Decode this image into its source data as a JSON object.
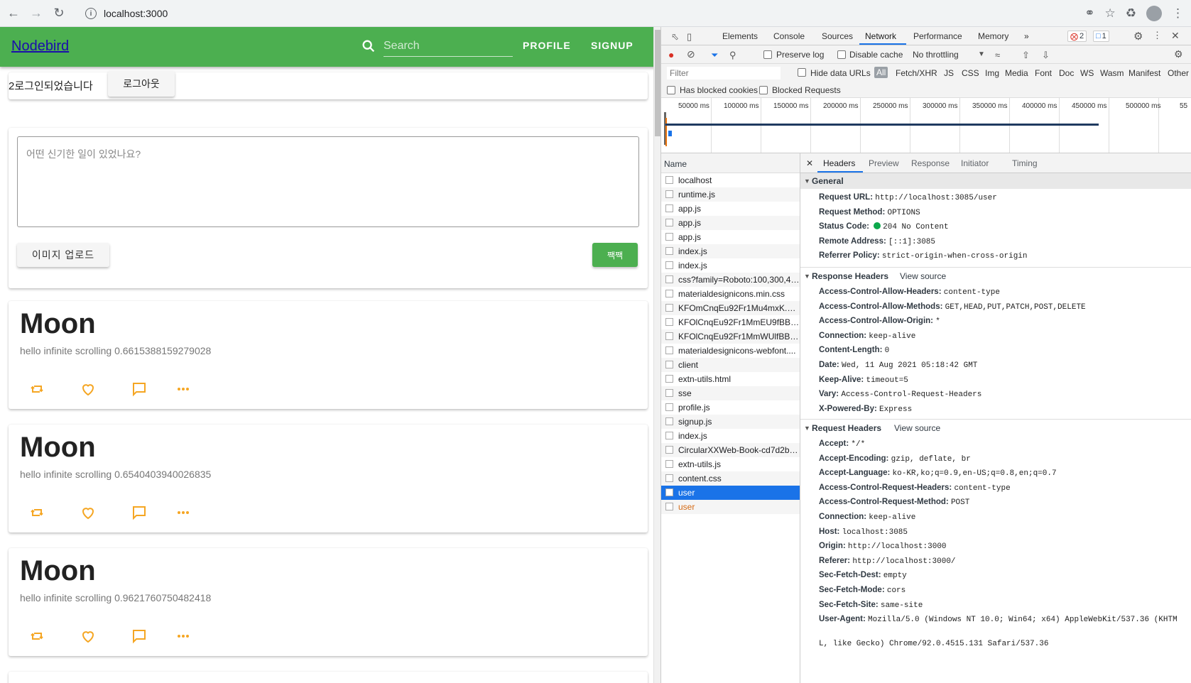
{
  "browser": {
    "url": "localhost:3000",
    "back_icon": "arrow-left-icon",
    "forward_icon": "arrow-right-icon",
    "reload_icon": "reload-icon"
  },
  "app": {
    "brand": "Nodebird",
    "search_placeholder": "Search",
    "nav": [
      "PROFILE",
      "SIGNUP"
    ],
    "login_text": "2로그인되었습니다",
    "logout_label": "로그아웃",
    "post_placeholder": "어떤 신기한 일이 있었나요?",
    "upload_label": "이미지 업로드",
    "submit_label": "짹짹",
    "accent": "#4caf50",
    "action_color": "#f5a623",
    "posts": [
      {
        "title": "Moon",
        "body": "hello infinite scrolling 0.6615388159279028"
      },
      {
        "title": "Moon",
        "body": "hello infinite scrolling 0.6540403940026835"
      },
      {
        "title": "Moon",
        "body": "hello infinite scrolling 0.9621760750482418"
      }
    ]
  },
  "devtools": {
    "tabs": [
      "Elements",
      "Console",
      "Sources",
      "Network",
      "Performance",
      "Memory"
    ],
    "active_tab": "Network",
    "error_count": "2",
    "message_count": "1",
    "toolbar": {
      "preserve_log": "Preserve log",
      "disable_cache": "Disable cache",
      "throttling": "No throttling"
    },
    "filter_placeholder": "Filter",
    "hide_data_urls": "Hide data URLs",
    "filter_types": [
      "All",
      "Fetch/XHR",
      "JS",
      "CSS",
      "Img",
      "Media",
      "Font",
      "Doc",
      "WS",
      "Wasm",
      "Manifest",
      "Other"
    ],
    "has_blocked_cookies": "Has blocked cookies",
    "blocked_requests": "Blocked Requests",
    "timeline_ticks": [
      "50000 ms",
      "100000 ms",
      "150000 ms",
      "200000 ms",
      "250000 ms",
      "300000 ms",
      "350000 ms",
      "400000 ms",
      "450000 ms",
      "500000 ms",
      "55"
    ],
    "name_header": "Name",
    "requests": [
      {
        "name": "localhost",
        "state": "normal"
      },
      {
        "name": "runtime.js",
        "state": "normal"
      },
      {
        "name": "app.js",
        "state": "normal"
      },
      {
        "name": "app.js",
        "state": "normal"
      },
      {
        "name": "app.js",
        "state": "normal"
      },
      {
        "name": "index.js",
        "state": "normal"
      },
      {
        "name": "index.js",
        "state": "normal"
      },
      {
        "name": "css?family=Roboto:100,300,400,...",
        "state": "normal"
      },
      {
        "name": "materialdesignicons.min.css",
        "state": "normal"
      },
      {
        "name": "KFOmCnqEu92Fr1Mu4mxK.wo...",
        "state": "normal"
      },
      {
        "name": "KFOlCnqEu92Fr1MmEU9fBBc4...",
        "state": "normal"
      },
      {
        "name": "KFOlCnqEu92Fr1MmWUlfBBc...",
        "state": "normal"
      },
      {
        "name": "materialdesignicons-webfont....",
        "state": "normal"
      },
      {
        "name": "client",
        "state": "normal"
      },
      {
        "name": "extn-utils.html",
        "state": "normal"
      },
      {
        "name": "sse",
        "state": "normal"
      },
      {
        "name": "profile.js",
        "state": "normal"
      },
      {
        "name": "signup.js",
        "state": "normal"
      },
      {
        "name": "index.js",
        "state": "normal"
      },
      {
        "name": "CircularXXWeb-Book-cd7d2bc...",
        "state": "normal"
      },
      {
        "name": "extn-utils.js",
        "state": "normal"
      },
      {
        "name": "content.css",
        "state": "normal"
      },
      {
        "name": "user",
        "state": "selected"
      },
      {
        "name": "user",
        "state": "error"
      }
    ],
    "detail_tabs": [
      "Headers",
      "Preview",
      "Response",
      "Initiator",
      "Timing"
    ],
    "active_detail_tab": "Headers",
    "general": {
      "title": "General",
      "rows": [
        {
          "k": "Request URL:",
          "v": "http://localhost:3085/user"
        },
        {
          "k": "Request Method:",
          "v": "OPTIONS"
        },
        {
          "k": "Status Code:",
          "v": "204 No Content"
        },
        {
          "k": "Remote Address:",
          "v": "[::1]:3085"
        },
        {
          "k": "Referrer Policy:",
          "v": "strict-origin-when-cross-origin"
        }
      ]
    },
    "response_headers": {
      "title": "Response Headers",
      "view_source": "View source",
      "rows": [
        {
          "k": "Access-Control-Allow-Headers:",
          "v": "content-type"
        },
        {
          "k": "Access-Control-Allow-Methods:",
          "v": "GET,HEAD,PUT,PATCH,POST,DELETE"
        },
        {
          "k": "Access-Control-Allow-Origin:",
          "v": "*"
        },
        {
          "k": "Connection:",
          "v": "keep-alive"
        },
        {
          "k": "Content-Length:",
          "v": "0"
        },
        {
          "k": "Date:",
          "v": "Wed, 11 Aug 2021 05:18:42 GMT"
        },
        {
          "k": "Keep-Alive:",
          "v": "timeout=5"
        },
        {
          "k": "Vary:",
          "v": "Access-Control-Request-Headers"
        },
        {
          "k": "X-Powered-By:",
          "v": "Express"
        }
      ]
    },
    "request_headers": {
      "title": "Request Headers",
      "view_source": "View source",
      "rows": [
        {
          "k": "Accept:",
          "v": "*/*"
        },
        {
          "k": "Accept-Encoding:",
          "v": "gzip, deflate, br"
        },
        {
          "k": "Accept-Language:",
          "v": "ko-KR,ko;q=0.9,en-US;q=0.8,en;q=0.7"
        },
        {
          "k": "Access-Control-Request-Headers:",
          "v": "content-type"
        },
        {
          "k": "Access-Control-Request-Method:",
          "v": "POST"
        },
        {
          "k": "Connection:",
          "v": "keep-alive"
        },
        {
          "k": "Host:",
          "v": "localhost:3085"
        },
        {
          "k": "Origin:",
          "v": "http://localhost:3000"
        },
        {
          "k": "Referer:",
          "v": "http://localhost:3000/"
        },
        {
          "k": "Sec-Fetch-Dest:",
          "v": "empty"
        },
        {
          "k": "Sec-Fetch-Mode:",
          "v": "cors"
        },
        {
          "k": "Sec-Fetch-Site:",
          "v": "same-site"
        },
        {
          "k": "User-Agent:",
          "v": "Mozilla/5.0 (Windows NT 10.0; Win64; x64) AppleWebKit/537.36 (KHTM"
        }
      ],
      "ua_continued": "L, like Gecko) Chrome/92.0.4515.131 Safari/537.36"
    }
  }
}
